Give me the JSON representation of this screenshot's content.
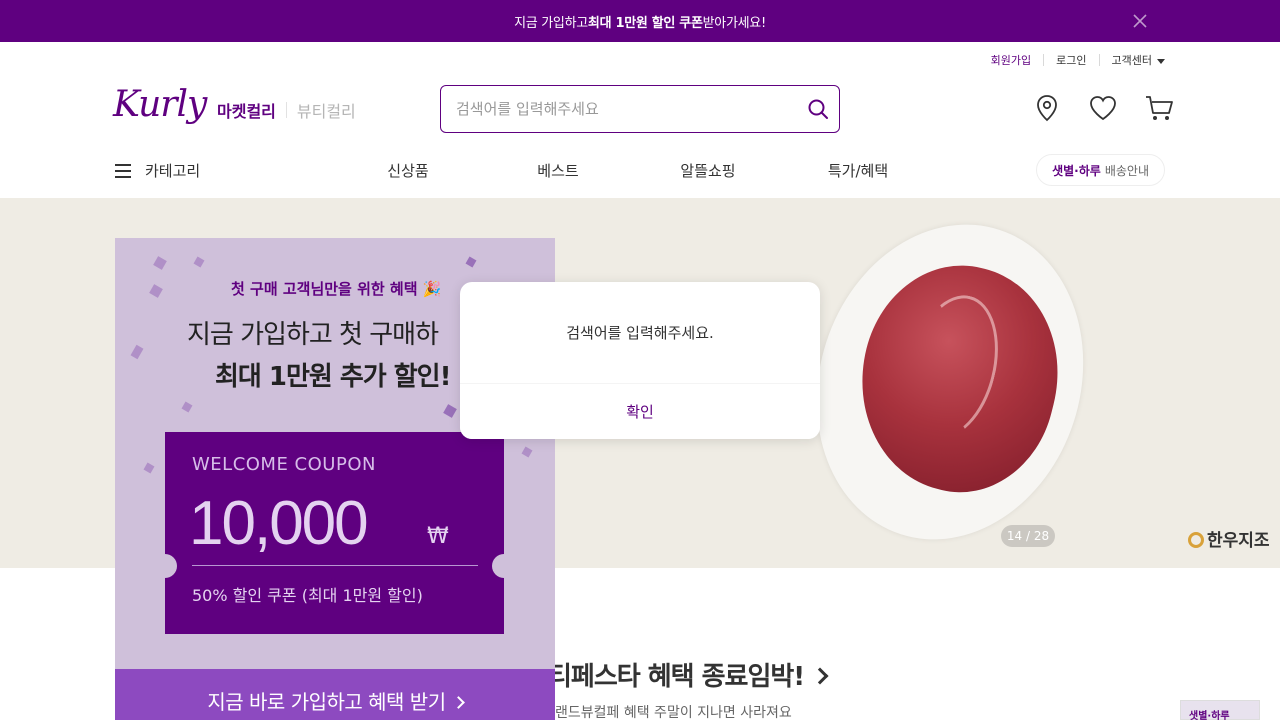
{
  "top_banner": {
    "text_prefix": "지금 가입하고 ",
    "text_bold": "최대 1만원 할인 쿠폰",
    "text_suffix": " 받아가세요!"
  },
  "util_links": {
    "signup": "회원가입",
    "login": "로그인",
    "customer_center": "고객센터"
  },
  "logo": "Kurly",
  "market_tabs": {
    "market": "마켓컬리",
    "beauty": "뷰티컬리"
  },
  "search": {
    "placeholder": "검색어를 입력해주세요"
  },
  "gnb": {
    "category": "카테고리",
    "menu": [
      "신상품",
      "베스트",
      "알뜰쇼핑",
      "특가/혜택"
    ],
    "delivery_bold": "샛별·하루",
    "delivery_text": "배송안내"
  },
  "hero": {
    "slide_counter": "14 / 28",
    "brand": "한우지조"
  },
  "signup_popup": {
    "subtitle": "첫 구매 고객님만을 위한 혜택 🎉",
    "title_line1": "지금 가입하고 첫 구매하",
    "title_line2": "최대 1만원 추가 할인!",
    "coupon_label": "WELCOME COUPON",
    "coupon_amount": "10,000",
    "coupon_unit": "₩",
    "coupon_desc": "50% 할인 쿠폰 (최대 1만원 할인)",
    "cta": "지금 바로 가입하고 혜택 받기"
  },
  "section": {
    "title": "티페스타 혜택 종료임박!",
    "subtitle": "랜드뷰컬페 혜택 주말이 지나면 사라져요",
    "thumb_label": "샛별·하루"
  },
  "alert": {
    "message": "검색어를 입력해주세요.",
    "ok_label": "확인"
  },
  "colors": {
    "brand_purple": "#5f0080",
    "hero_bg": "#efece4",
    "popup_bg": "#cfc0da"
  }
}
